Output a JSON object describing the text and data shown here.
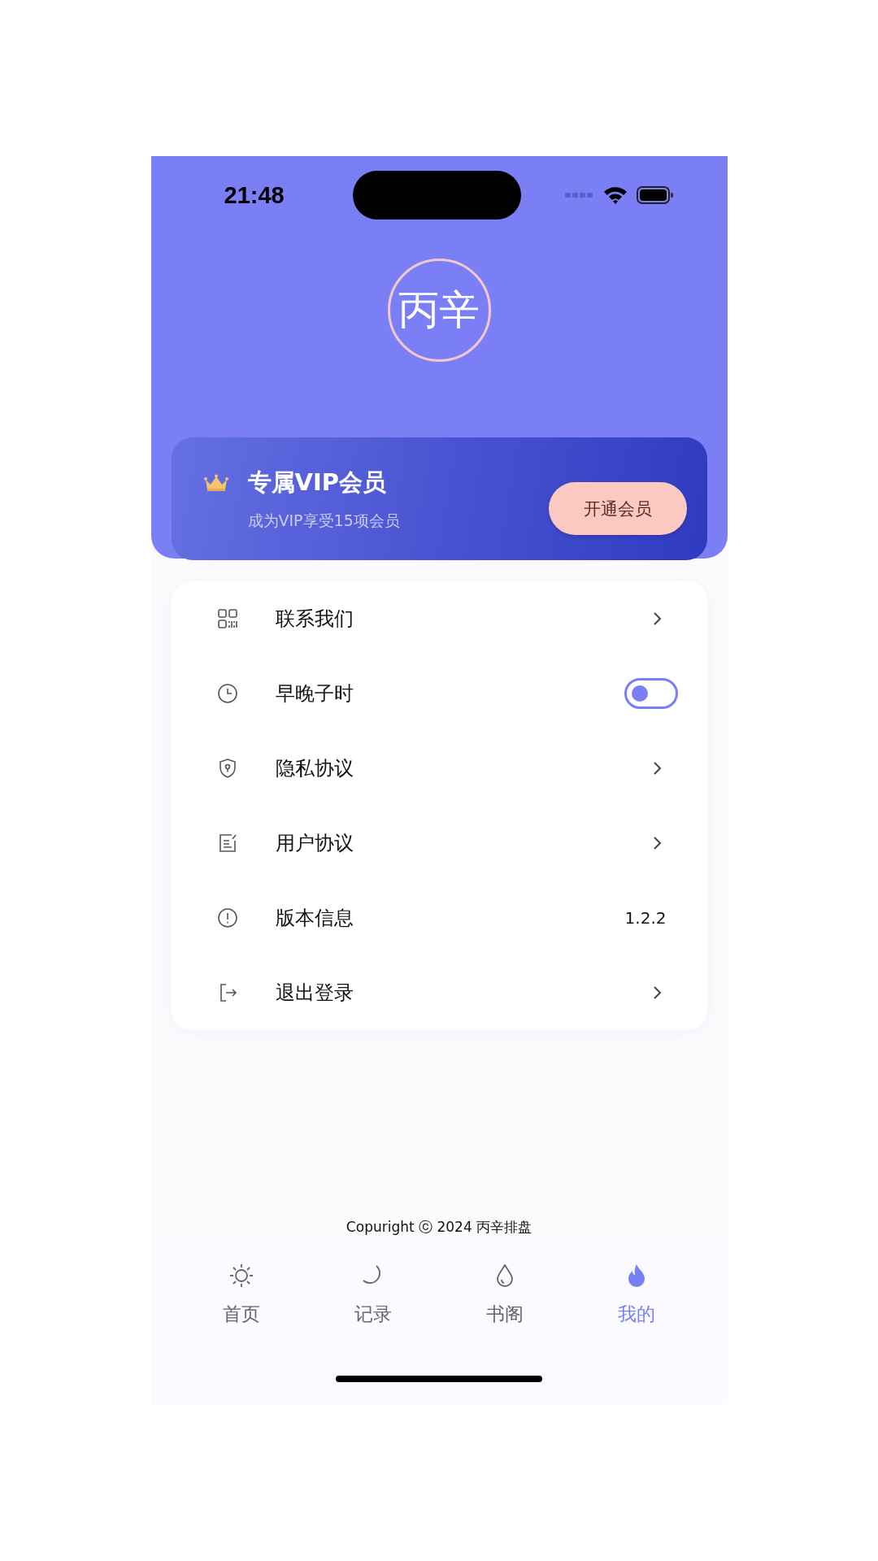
{
  "status_bar": {
    "time": "21:48"
  },
  "logo": {
    "text": "丙辛"
  },
  "vip_card": {
    "title": "专属VIP会员",
    "subtitle": "成为VIP享受15项会员",
    "button": "开通会员"
  },
  "menu": [
    {
      "kind": "link",
      "label": "联系我们"
    },
    {
      "kind": "toggle",
      "label": "早晚子时",
      "on": false
    },
    {
      "kind": "link",
      "label": "隐私协议"
    },
    {
      "kind": "link",
      "label": "用户协议"
    },
    {
      "kind": "value",
      "label": "版本信息",
      "value": "1.2.2"
    },
    {
      "kind": "link",
      "label": "退出登录"
    }
  ],
  "copyright": "Copuright ⓒ 2024 丙辛排盘",
  "tabs": [
    {
      "label": "首页",
      "selected": false
    },
    {
      "label": "记录",
      "selected": false
    },
    {
      "label": "书阁",
      "selected": false
    },
    {
      "label": "我的",
      "selected": true
    }
  ]
}
